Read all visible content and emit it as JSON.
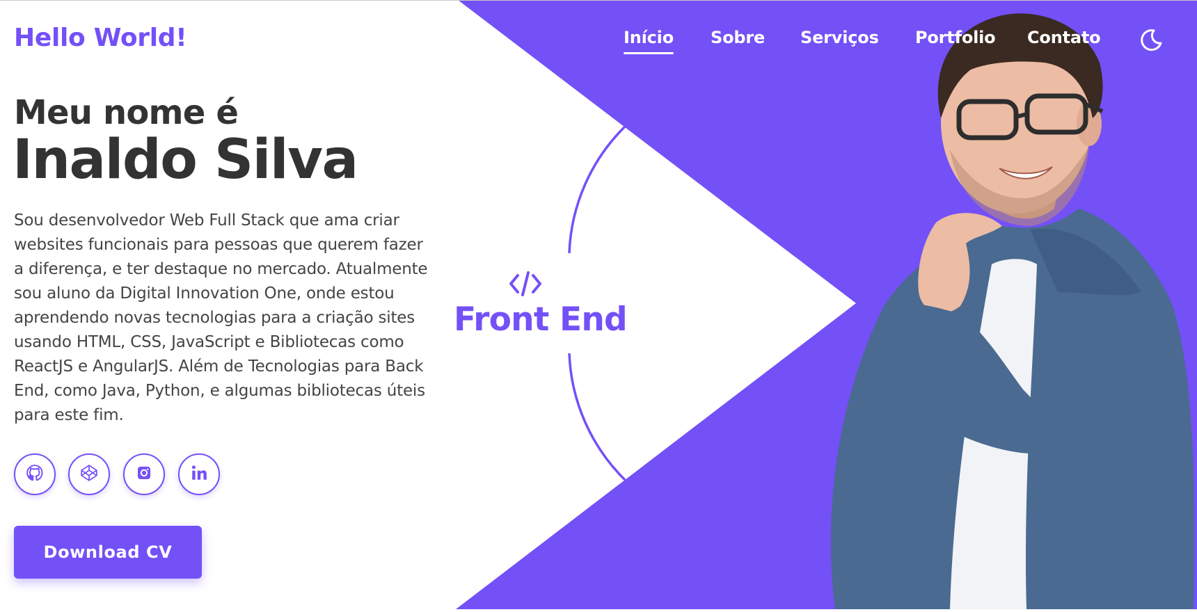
{
  "brand": {
    "logo_text": "Hello World!"
  },
  "nav": {
    "items": [
      {
        "label": "Início",
        "active": true
      },
      {
        "label": "Sobre",
        "active": false
      },
      {
        "label": "Serviços",
        "active": false
      },
      {
        "label": "Portfolio",
        "active": false
      },
      {
        "label": "Contato",
        "active": false
      }
    ],
    "theme_toggle_icon": "moon-icon"
  },
  "hero": {
    "pre_title": "Meu nome é",
    "name": "Inaldo Silva",
    "description": "Sou desenvolvedor Web Full Stack que ama criar websites funcionais para pessoas que querem fazer a diferença, e ter destaque no mercado. Atualmente sou aluno da Digital Innovation One, onde estou aprendendo novas tecnologias para a criação sites usando HTML, CSS, JavaScript e Bibliotecas como ReactJS e AngularJS. Além de Tecnologias para Back End, como Java, Python, e algumas bibliotecas úteis para este fim.",
    "socials": [
      {
        "icon": "github-icon"
      },
      {
        "icon": "codepen-icon"
      },
      {
        "icon": "instagram-icon"
      },
      {
        "icon": "linkedin-icon"
      }
    ],
    "cta_label": "Download CV"
  },
  "specialty": {
    "icon": "code-icon",
    "label": "Front End"
  },
  "colors": {
    "accent": "#7450f7",
    "text": "#333333",
    "muted_text": "#444444",
    "background": "#ffffff"
  }
}
